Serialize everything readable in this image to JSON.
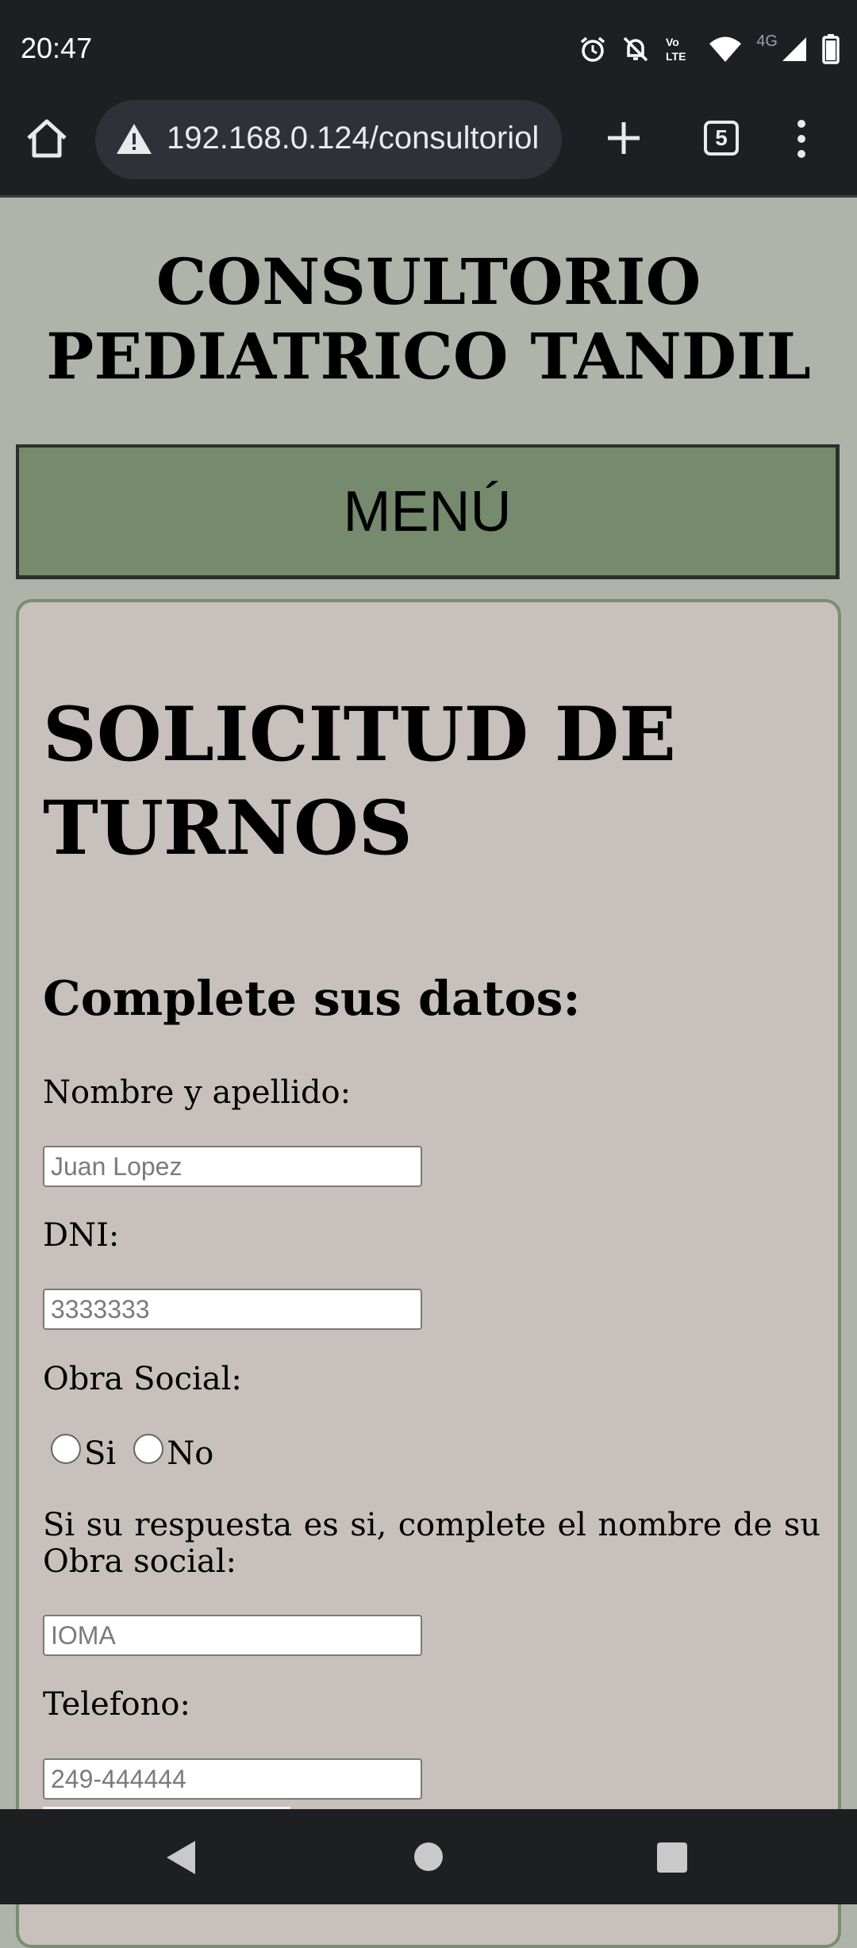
{
  "status_bar": {
    "time": "20:47",
    "icons": [
      "alarm-icon",
      "bell-off-icon",
      "volte-icon",
      "wifi-icon",
      "4g-label",
      "signal-icon",
      "battery-icon"
    ],
    "network_label": "4G",
    "volte_label": "Vo LTE"
  },
  "browser": {
    "url": "192.168.0.124/consultoriol",
    "tab_count": "5"
  },
  "page": {
    "site_title_line1": "CONSULTORIO",
    "site_title_line2": "PEDIATRICO TANDIL",
    "menu_label": "MENÚ",
    "form_title_line1": "SOLICITUD DE",
    "form_title_line2": "TURNOS",
    "form_subtitle": "Complete sus datos:",
    "fields": {
      "name_label": "Nombre y apellido:",
      "name_placeholder": "Juan Lopez",
      "dni_label": "DNI:",
      "dni_placeholder": "3333333",
      "obra_social_label": "Obra Social:",
      "radio_yes": "Si",
      "radio_no": "No",
      "obra_social_note": "Si su respuesta es si, complete el nombre de su Obra social:",
      "obra_social_placeholder": "IOMA",
      "phone_label": "Telefono:",
      "phone_placeholder": "249-444444"
    }
  },
  "colors": {
    "page_bg": "#aeb4a9",
    "menu_bg": "#768a6d",
    "card_bg": "#c7c0bc",
    "card_border": "#798e70",
    "system_bar": "#1d1f22"
  }
}
